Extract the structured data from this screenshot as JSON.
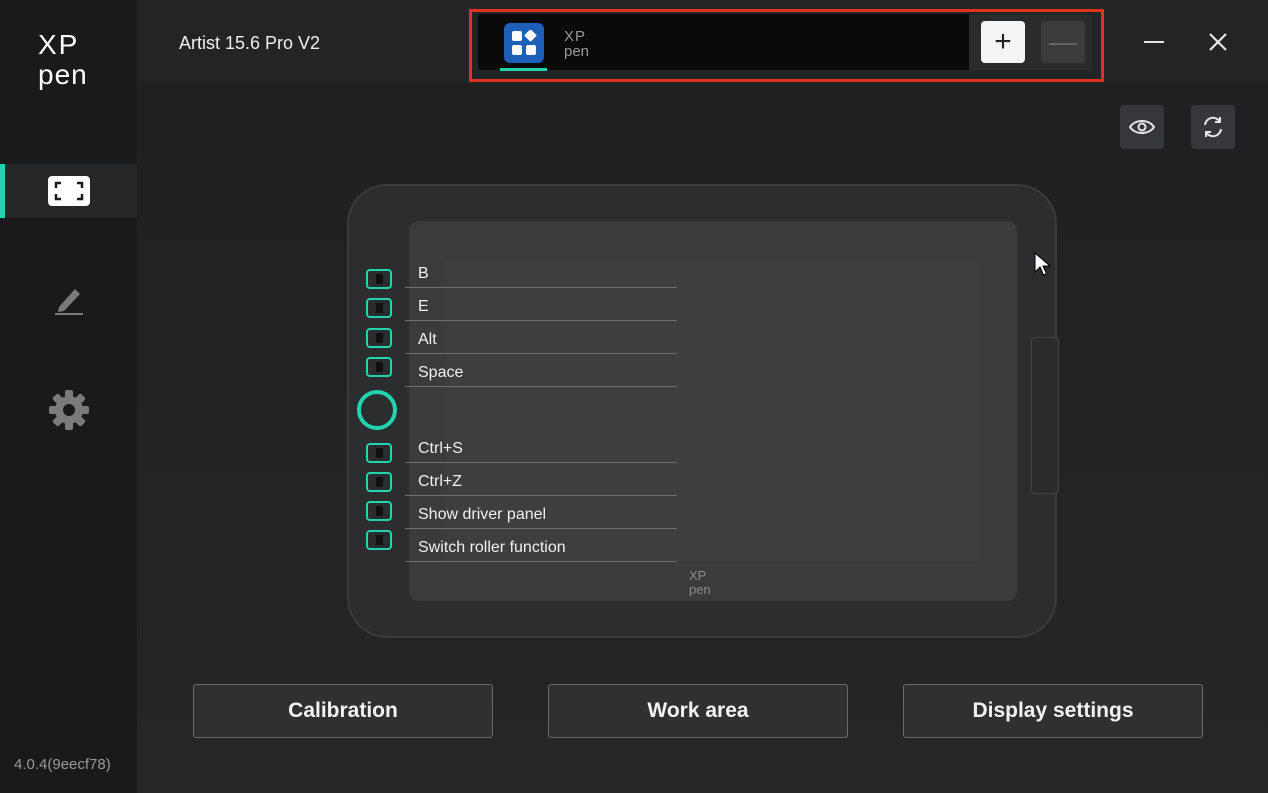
{
  "app": {
    "logo_text_top": "XP",
    "logo_text_bottom": "pen",
    "version": "4.0.4(9eecf78)"
  },
  "sidebar": {
    "items": [
      {
        "name": "display-mapping",
        "icon": "screen-frame-icon",
        "active": true
      },
      {
        "name": "pen",
        "icon": "pen-icon",
        "active": false
      },
      {
        "name": "settings",
        "icon": "gear-icon",
        "active": false
      }
    ]
  },
  "header": {
    "device_name": "Artist 15.6 Pro V2",
    "tabs": [
      {
        "label": "",
        "icon": "apps-grid-icon",
        "selected": true
      },
      {
        "label": "XP pen",
        "icon": "xppen-logo-icon",
        "selected": false
      }
    ],
    "add_label": "+",
    "remove_label": "—",
    "minimize_icon": "minimize-icon",
    "close_icon": "close-icon"
  },
  "toolbar": {
    "preview_icon": "eye-icon",
    "refresh_icon": "refresh-icon"
  },
  "tablet": {
    "keys_top": [
      "B",
      "E",
      "Alt",
      "Space"
    ],
    "keys_bottom": [
      "Ctrl+S",
      "Ctrl+Z",
      "Show driver panel",
      "Switch roller function"
    ],
    "screen_logo_top": "XP",
    "screen_logo_bottom": "pen"
  },
  "actions": {
    "calibration": "Calibration",
    "work_area": "Work area",
    "display_settings": "Display settings"
  },
  "colors": {
    "accent": "#22d3b0",
    "highlight": "#e0321f",
    "tab_app": "#1e5fb8"
  }
}
